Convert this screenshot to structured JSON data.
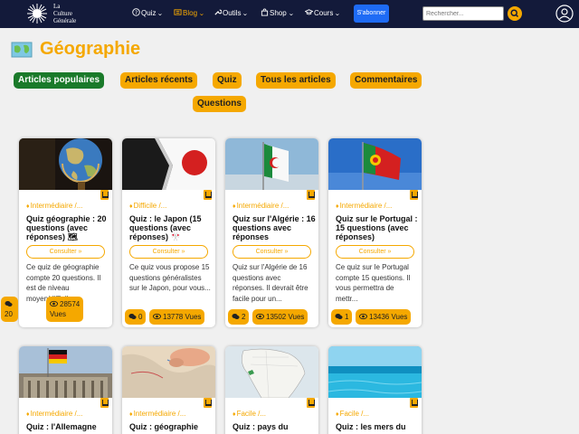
{
  "logo": {
    "line1": "La",
    "line2": "Culture",
    "line3": "Générale"
  },
  "nav": {
    "quiz": "Quiz",
    "blog": "Blog",
    "outils": "Outils",
    "shop": "Shop",
    "cours": "Cours",
    "subscribe": "S'abonner",
    "search_placeholder": "Rechercher..."
  },
  "page": {
    "title": "Géographie"
  },
  "tabs": [
    "Articles populaires",
    "Articles récents",
    "Quiz",
    "Tous les articles",
    "Commentaires",
    "Questions"
  ],
  "cards": [
    {
      "level": "Intermédiaire /...",
      "title": "Quiz géographie : 20 questions (avec réponses) 🗺",
      "consult": "Consulter »",
      "excerpt": "Ce quiz de géographie compte 20 questions. Il est de niveau moyen/difficile",
      "comments": "20",
      "views": "28574",
      "views_label": "Vues"
    },
    {
      "level": "Difficile /...",
      "title": "Quiz : le Japon (15 questions (avec réponses) 🎌",
      "consult": "Consulter »",
      "excerpt": "Ce quiz vous propose 15 questions généralistes sur le Japon, pour vous...",
      "comments": "0",
      "views": "13778 Vues"
    },
    {
      "level": "Intermédiaire /...",
      "title": "Quiz sur l'Algérie : 16 questions avec réponses",
      "consult": "Consulter »",
      "excerpt": "Quiz sur l'Algérie de 16 questions avec réponses. Il devrait être facile pour un...",
      "comments": "2",
      "views": "13502 Vues"
    },
    {
      "level": "Intermédiaire /...",
      "title": "Quiz sur le Portugal : 15 questions (avec réponses)",
      "consult": "Consulter »",
      "excerpt": "Ce quiz sur le Portugal compte 15 questions. Il vous permettra de mettr...",
      "comments": "1",
      "views": "13436 Vues"
    },
    {
      "level": "Intermédiaire /...",
      "title": "Quiz : l'Allemagne"
    },
    {
      "level": "Intermédiaire /...",
      "title": "Quiz : géographie"
    },
    {
      "level": "Facile /...",
      "title": "Quiz : pays du"
    },
    {
      "level": "Facile /...",
      "title": "Quiz : les mers du"
    }
  ]
}
